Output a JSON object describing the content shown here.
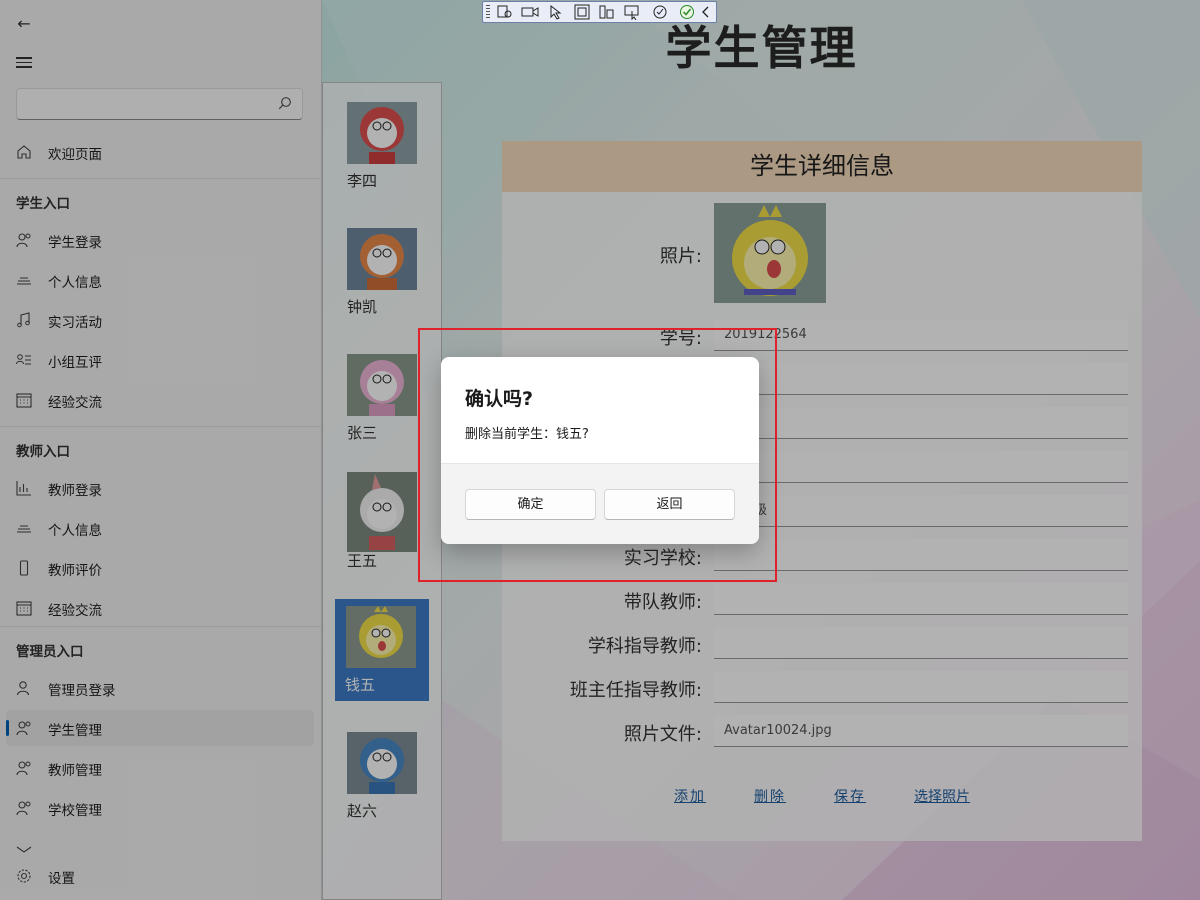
{
  "nav": {
    "search": {
      "placeholder": ""
    },
    "welcome": "欢迎页面",
    "sections": [
      {
        "header": "学生入口",
        "items": [
          "学生登录",
          "个人信息",
          "实习活动",
          "小组互评",
          "经验交流"
        ]
      },
      {
        "header": "教师入口",
        "items": [
          "教师登录",
          "个人信息",
          "教师评价",
          "经验交流"
        ]
      },
      {
        "header": "管理员入口",
        "items": [
          "管理员登录",
          "学生管理",
          "教师管理",
          "学校管理"
        ]
      }
    ],
    "active_item": "学生管理",
    "settings": "设置"
  },
  "main": {
    "title": "学生管理",
    "students": [
      "李四",
      "钟凯",
      "张三",
      "王五",
      "钱五",
      "赵六"
    ],
    "selected_student": "钱五",
    "detail": {
      "header": "学生详细信息",
      "photo_label": "照片:",
      "fields": [
        {
          "label": "学号:",
          "value": "2019122564"
        },
        {
          "label": "",
          "value": ""
        },
        {
          "label": "",
          "value": ""
        },
        {
          "label": "",
          "value": ""
        },
        {
          "label": "",
          "value": "级"
        },
        {
          "label": "实习学校:",
          "value": ""
        },
        {
          "label": "带队教师:",
          "value": ""
        },
        {
          "label": "学科指导教师:",
          "value": ""
        },
        {
          "label": "班主任指导教师:",
          "value": ""
        },
        {
          "label": "照片文件:",
          "value": "Avatar10024.jpg"
        }
      ],
      "actions": {
        "add": "添加",
        "delete": "删除",
        "save": "保存",
        "choose_photo": "选择照片"
      }
    }
  },
  "dialog": {
    "title": "确认吗?",
    "message": "删除当前学生：钱五?",
    "confirm": "确定",
    "back": "返回"
  },
  "colors": {
    "accent": "#005fb8",
    "highlight_rect": "#e0232b",
    "detail_header_bg": "#f5dcbc",
    "selected_student_bg": "#3d7bc7",
    "link": "#1f5fa0"
  }
}
